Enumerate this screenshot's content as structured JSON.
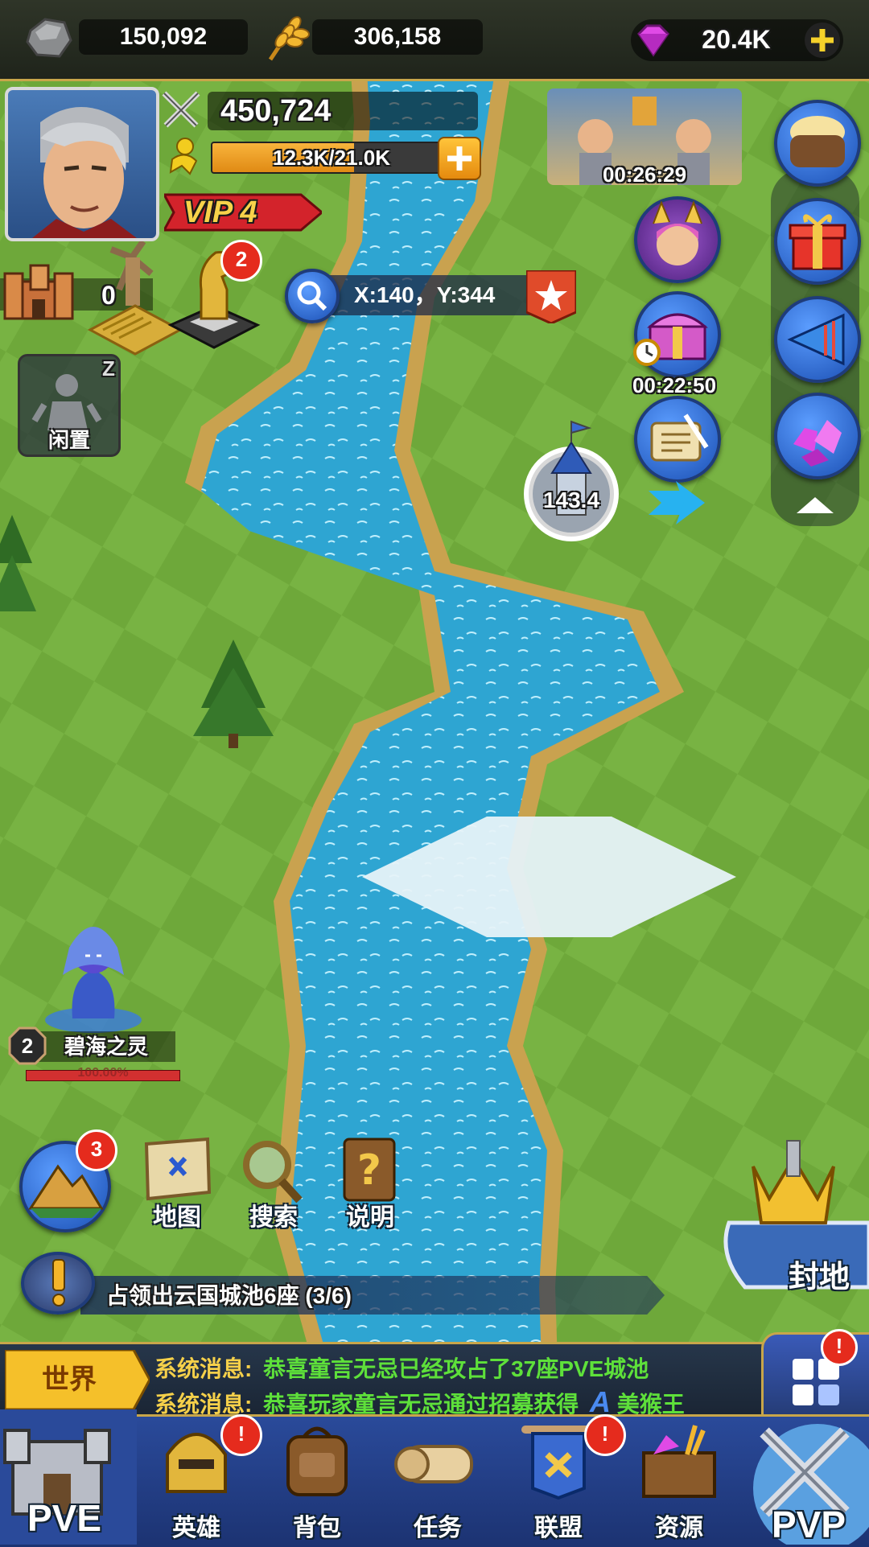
{
  "resources": {
    "stone": "150,092",
    "wheat": "306,158",
    "gems": "20.4K"
  },
  "player": {
    "power": "450,724",
    "exp": "12.3K/21.0K",
    "exp_fraction": 0.586,
    "vip": "VIP 4"
  },
  "city": {
    "count": "0",
    "badge": "2"
  },
  "idle": {
    "label": "闲置",
    "z": "Z"
  },
  "search": {
    "coords": "X:140，Y:344"
  },
  "timers": {
    "event": "00:26:29",
    "chest": "00:22:50"
  },
  "tower": {
    "value": "143.4"
  },
  "monster": {
    "level": "2",
    "name": "碧海之灵",
    "hp": "100.00%"
  },
  "tools": {
    "badge": "3",
    "map": "地图",
    "search": "搜索",
    "help": "说明"
  },
  "quest": {
    "text": "占领出云国城池6座 (3/6)"
  },
  "fief": {
    "label": "封地"
  },
  "chat": {
    "channel": "世界",
    "lines": [
      {
        "prefix": "系统消息:",
        "text": "恭喜童言无忌已经攻占了37座PVE城池"
      },
      {
        "prefix": "系统消息:",
        "text": "恭喜玩家童言无忌通过招募获得",
        "grade": "A",
        "hero": "美猴王"
      }
    ]
  },
  "nav": {
    "pve": "PVE",
    "pvp": "PVP",
    "items": [
      {
        "label": "英雄",
        "alert": "!"
      },
      {
        "label": "背包",
        "alert": ""
      },
      {
        "label": "任务",
        "alert": ""
      },
      {
        "label": "联盟",
        "alert": "!"
      },
      {
        "label": "资源",
        "alert": ""
      }
    ],
    "menu_alert": "!"
  },
  "colors": {
    "gold": "#c8a64a",
    "river": "#2fa9d6",
    "grass": "#6da53a",
    "chat_green": "#5ee03a"
  }
}
